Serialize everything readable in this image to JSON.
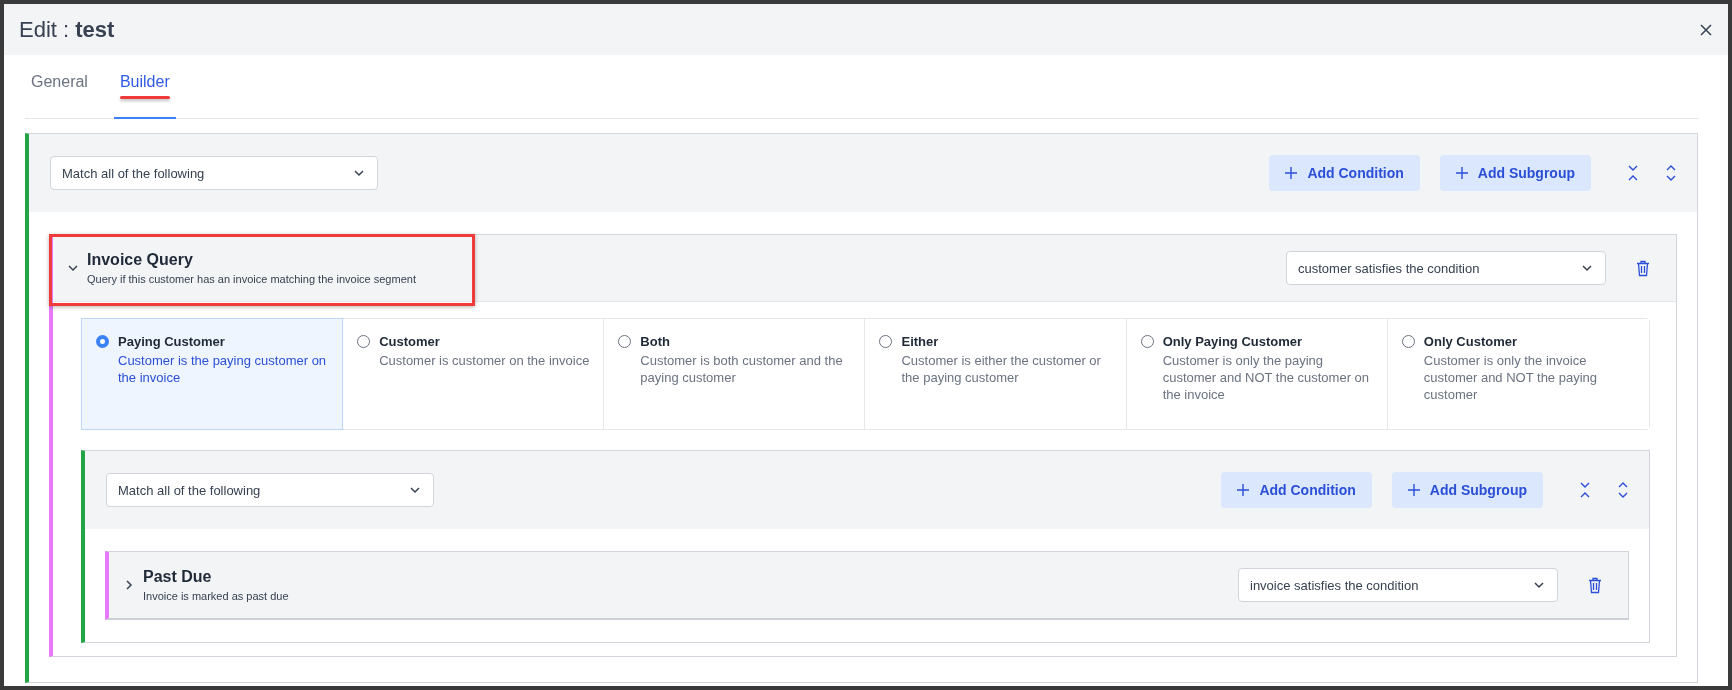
{
  "window": {
    "title_prefix": "Edit : ",
    "title_name": "test"
  },
  "tabs": [
    {
      "label": "General",
      "selected": false
    },
    {
      "label": "Builder",
      "selected": true
    }
  ],
  "builder": {
    "match": "Match all of the following",
    "buttons": [
      "Add Condition",
      "Add Subgroup"
    ],
    "items": [
      {
        "title": "Invoice Query",
        "description": "Query if this customer has an invoice matching the invoice segment",
        "expanded": true,
        "highlighted": true,
        "condition": "customer satisfies the condition",
        "options": [
          {
            "label": "Paying Customer",
            "description": "Customer is the paying customer on the invoice",
            "selected": true
          },
          {
            "label": "Customer",
            "description": "Customer is customer on the invoice",
            "selected": false
          },
          {
            "label": "Both",
            "description": "Customer is both customer and the paying customer",
            "selected": false
          },
          {
            "label": "Either",
            "description": "Customer is either the customer or the paying customer",
            "selected": false
          },
          {
            "label": "Only Paying Customer",
            "description": "Customer is only the paying customer and NOT the customer on the invoice",
            "selected": false
          },
          {
            "label": "Only Customer",
            "description": "Customer is only the invoice customer and NOT the paying customer",
            "selected": false
          }
        ],
        "group": {
          "match": "Match all of the following",
          "buttons": [
            "Add Condition",
            "Add Subgroup"
          ],
          "items": [
            {
              "title": "Past Due",
              "description": "Invoice is marked as past due",
              "expanded": false,
              "highlighted": false,
              "condition": "invoice satisfies the condition"
            }
          ]
        }
      }
    ]
  }
}
